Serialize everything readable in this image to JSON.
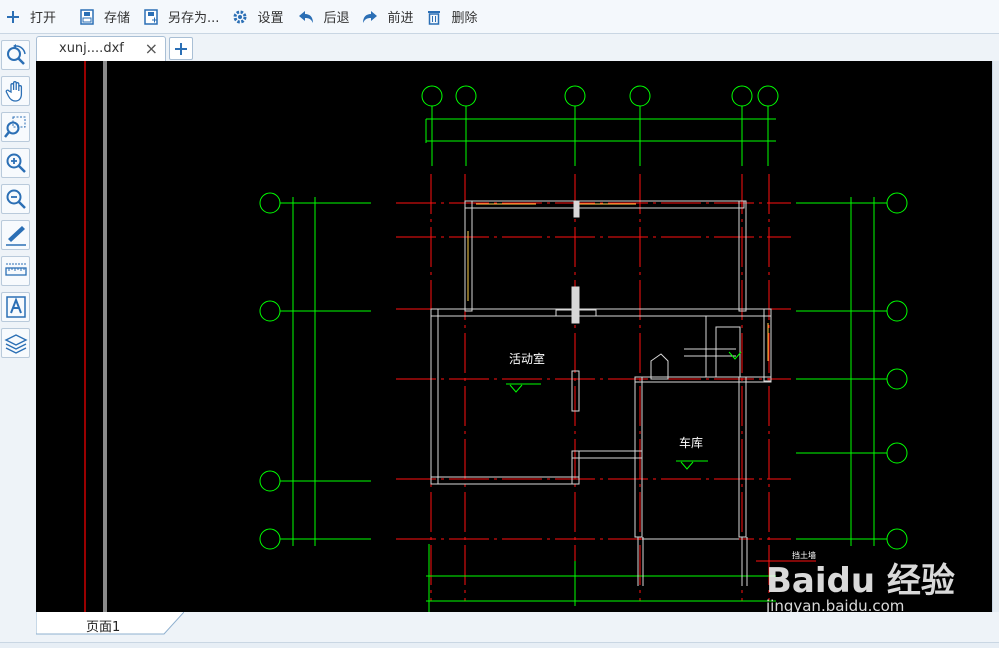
{
  "toolbar": {
    "open": "打开",
    "save": "存储",
    "save_as": "另存为...",
    "settings": "设置",
    "back": "后退",
    "forward": "前进",
    "delete": "删除"
  },
  "tab": {
    "filename": "xunj....dxf",
    "close": "×",
    "add": "+"
  },
  "left_tools": [
    "rotate-zoom-icon",
    "pan-hand-icon",
    "zoom-window-icon",
    "zoom-in-icon",
    "zoom-out-icon",
    "line-draw-icon",
    "measure-ruler-icon",
    "text-A-icon",
    "layers-icon"
  ],
  "drawing": {
    "room_activity": "活动室",
    "room_garage": "车库",
    "wall_note": "挡土墙"
  },
  "watermark": {
    "brand": "Baidu 经验",
    "url": "jingyan.baidu.com"
  },
  "bottom": {
    "page_tab": "页面1"
  },
  "colors": {
    "grid_green": "#00ff00",
    "axis_red": "#ff0000",
    "canvas_bg": "#000000",
    "accent_blue": "#2b6fb5"
  }
}
